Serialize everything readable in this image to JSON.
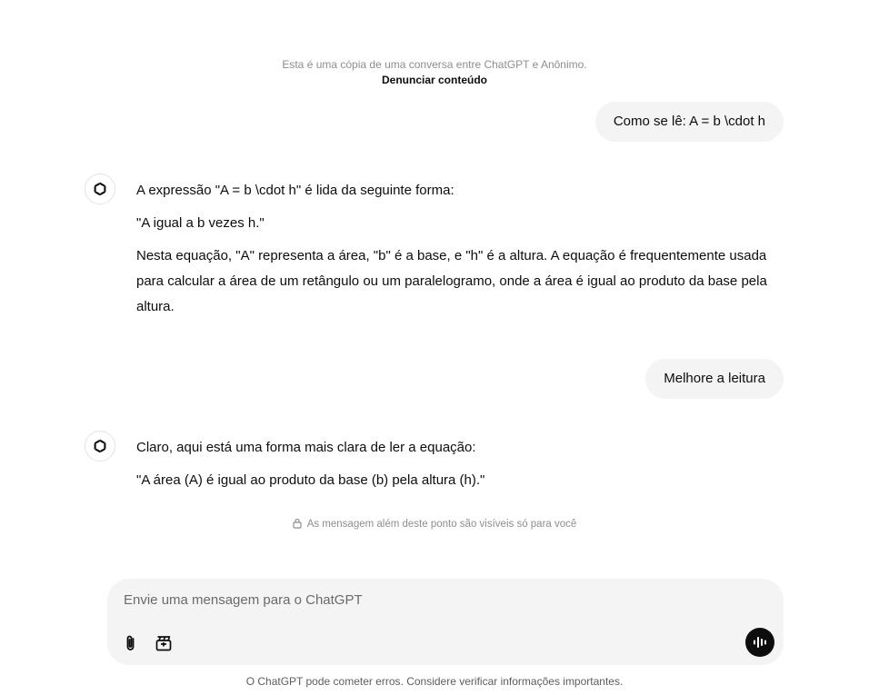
{
  "share_notice": {
    "text": "Esta é uma cópia de uma conversa entre ChatGPT e Anônimo.",
    "report_link": "Denunciar conteúdo"
  },
  "messages": [
    {
      "role": "user",
      "text": "Como se lê: A = b \\cdot h"
    },
    {
      "role": "assistant",
      "icon": "chatgpt-logo-icon",
      "paragraphs": [
        "A expressão \"A = b \\cdot h\" é lida da seguinte forma:",
        "\"A igual a b vezes h.\"",
        "Nesta equação, \"A\" representa a área, \"b\" é a base, e \"h\" é a altura. A equação é frequentemente usada para calcular a área de um retângulo ou um paralelogramo, onde a área é igual ao produto da base pela altura."
      ]
    },
    {
      "role": "user",
      "text": "Melhore a leitura"
    },
    {
      "role": "assistant",
      "icon": "chatgpt-logo-icon",
      "paragraphs": [
        "Claro, aqui está uma forma mais clara de ler a equação:",
        "\"A área (A) é igual ao produto da base (b) pela altura (h).\""
      ]
    }
  ],
  "visibility_notice": {
    "icon": "lock-icon",
    "text": "As mensagem além deste ponto são visíveis só para você"
  },
  "composer": {
    "placeholder": "Envie uma mensagem para o ChatGPT",
    "attach_icon": "paperclip-icon",
    "tools_icon": "tools-icon",
    "voice_icon": "voice-mode-icon"
  },
  "footer": {
    "disclaimer": "O ChatGPT pode cometer erros. Considere verificar informações importantes."
  },
  "colors": {
    "bubble_bg": "#f4f4f4",
    "muted_text": "#8e8e8e",
    "voice_button": "#0d0d0d"
  }
}
